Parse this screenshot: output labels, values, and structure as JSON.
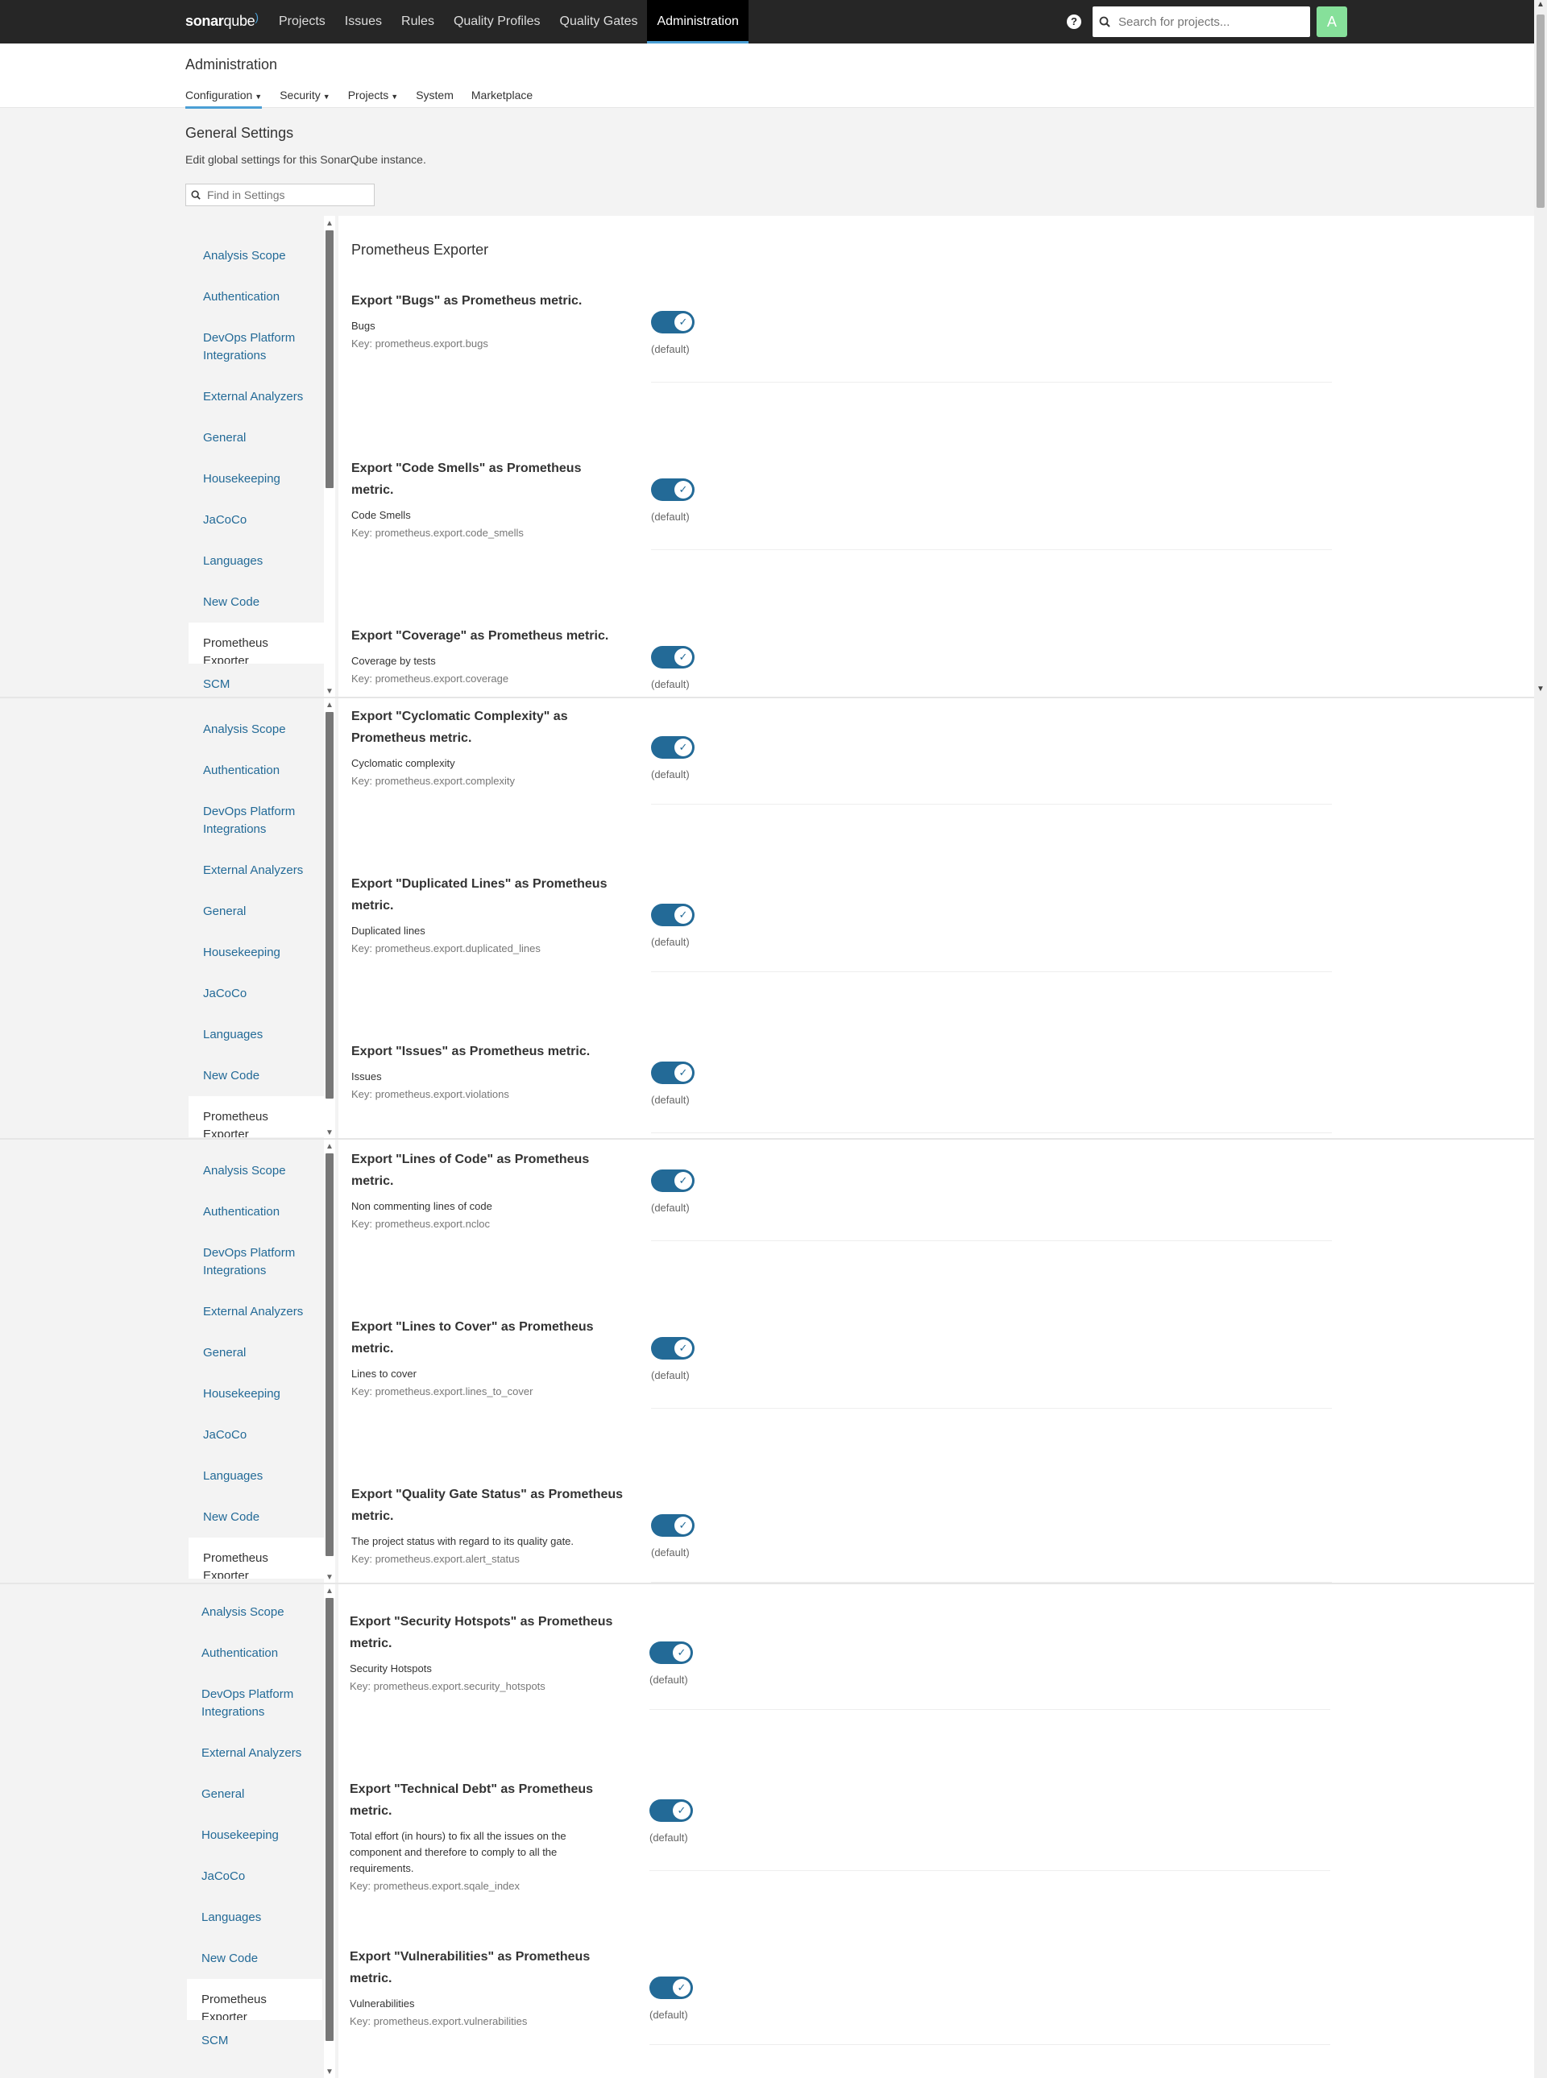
{
  "nav": {
    "logo_text": "sonarqube",
    "links": [
      "Projects",
      "Issues",
      "Rules",
      "Quality Profiles",
      "Quality Gates",
      "Administration"
    ],
    "active": "Administration",
    "search_placeholder": "Search for projects...",
    "avatar_letter": "A"
  },
  "admin": {
    "title": "Administration",
    "subnav": [
      {
        "label": "Configuration",
        "caret": true
      },
      {
        "label": "Security",
        "caret": true
      },
      {
        "label": "Projects",
        "caret": true
      },
      {
        "label": "System",
        "caret": false
      },
      {
        "label": "Marketplace",
        "caret": false
      }
    ]
  },
  "general": {
    "title": "General Settings",
    "description": "Edit global settings for this SonarQube instance.",
    "find_placeholder": "Find in Settings"
  },
  "sidebar_categories": [
    "Analysis Scope",
    "Authentication",
    "DevOps Platform Integrations",
    "External Analyzers",
    "General",
    "Housekeeping",
    "JaCoCo",
    "Languages",
    "New Code",
    "Prometheus Exporter",
    "SCM"
  ],
  "active_category": "Prometheus Exporter",
  "section_title": "Prometheus Exporter",
  "default_label": "(default)",
  "settings": [
    {
      "title": "Export \"Bugs\" as Prometheus metric.",
      "desc": "Bugs",
      "key": "Key: prometheus.export.bugs",
      "enabled": true
    },
    {
      "title": "Export \"Code Smells\" as Prometheus metric.",
      "desc": "Code Smells",
      "key": "Key: prometheus.export.code_smells",
      "enabled": true
    },
    {
      "title": "Export \"Coverage\" as Prometheus metric.",
      "desc": "Coverage by tests",
      "key": "Key: prometheus.export.coverage",
      "enabled": true
    },
    {
      "title": "Export \"Cyclomatic Complexity\" as Prometheus metric.",
      "desc": "Cyclomatic complexity",
      "key": "Key: prometheus.export.complexity",
      "enabled": true
    },
    {
      "title": "Export \"Duplicated Lines\" as Prometheus metric.",
      "desc": "Duplicated lines",
      "key": "Key: prometheus.export.duplicated_lines",
      "enabled": true
    },
    {
      "title": "Export \"Issues\" as Prometheus metric.",
      "desc": "Issues",
      "key": "Key: prometheus.export.violations",
      "enabled": true
    },
    {
      "title": "Export \"Lines of Code\" as Prometheus metric.",
      "desc": "Non commenting lines of code",
      "key": "Key: prometheus.export.ncloc",
      "enabled": true
    },
    {
      "title": "Export \"Lines to Cover\" as Prometheus metric.",
      "desc": "Lines to cover",
      "key": "Key: prometheus.export.lines_to_cover",
      "enabled": true
    },
    {
      "title": "Export \"Quality Gate Status\" as Prometheus metric.",
      "desc": "The project status with regard to its quality gate.",
      "key": "Key: prometheus.export.alert_status",
      "enabled": true
    },
    {
      "title": "Export \"Security Hotspots\" as Prometheus metric.",
      "desc": "Security Hotspots",
      "key": "Key: prometheus.export.security_hotspots",
      "enabled": true
    },
    {
      "title": "Export \"Technical Debt\" as Prometheus metric.",
      "desc": "Total effort (in hours) to fix all the issues on the component and therefore to comply to all the requirements.",
      "key": "Key: prometheus.export.sqale_index",
      "enabled": true
    },
    {
      "title": "Export \"Vulnerabilities\" as Prometheus metric.",
      "desc": "Vulnerabilities",
      "key": "Key: prometheus.export.vulnerabilities",
      "enabled": true
    }
  ]
}
